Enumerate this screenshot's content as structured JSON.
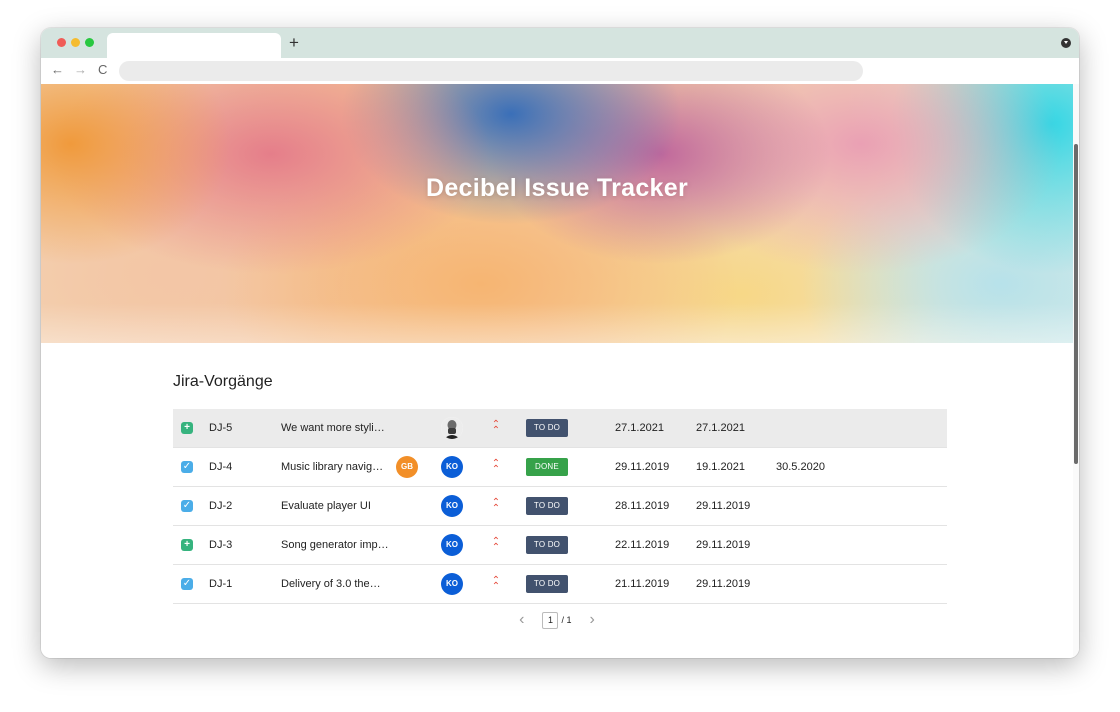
{
  "browser": {
    "new_tab": "+",
    "nav": {
      "back": "←",
      "forward": "→",
      "reload": "C"
    }
  },
  "hero": {
    "title": "Decibel Issue Tracker"
  },
  "section": {
    "title": "Jira-Vorgänge"
  },
  "issues": [
    {
      "type": "story",
      "type_icon": "story-plus-icon",
      "key": "DJ-5",
      "summary": "We want more styli…",
      "extra_assignee": "",
      "assignee": "photo",
      "priority": "highest",
      "status": "TO DO",
      "created": "27.1.2021",
      "updated": "27.1.2021",
      "due": ""
    },
    {
      "type": "task",
      "type_icon": "task-checkbox-icon",
      "key": "DJ-4",
      "summary": "Music library navig…",
      "extra_assignee": "GB",
      "assignee": "KO",
      "priority": "highest",
      "status": "DONE",
      "created": "29.11.2019",
      "updated": "19.1.2021",
      "due": "30.5.2020"
    },
    {
      "type": "task",
      "type_icon": "task-checkbox-icon",
      "key": "DJ-2",
      "summary": "Evaluate player UI",
      "extra_assignee": "",
      "assignee": "KO",
      "priority": "highest",
      "status": "TO DO",
      "created": "28.11.2019",
      "updated": "29.11.2019",
      "due": ""
    },
    {
      "type": "story",
      "type_icon": "story-plus-icon",
      "key": "DJ-3",
      "summary": "Song generator imp…",
      "extra_assignee": "",
      "assignee": "KO",
      "priority": "highest",
      "status": "TO DO",
      "created": "22.11.2019",
      "updated": "29.11.2019",
      "due": ""
    },
    {
      "type": "task",
      "type_icon": "task-checkbox-icon",
      "key": "DJ-1",
      "summary": "Delivery of 3.0 the…",
      "extra_assignee": "",
      "assignee": "KO",
      "priority": "highest",
      "status": "TO DO",
      "created": "21.11.2019",
      "updated": "29.11.2019",
      "due": ""
    }
  ],
  "pagination": {
    "prev": "‹",
    "current": "1",
    "total": "/ 1",
    "next": "›"
  },
  "colors": {
    "todo": "#42526e",
    "done": "#36a24a",
    "priority": "#e5493a",
    "avatar_ko": "#0b5ed7",
    "avatar_gb": "#f28f28"
  }
}
